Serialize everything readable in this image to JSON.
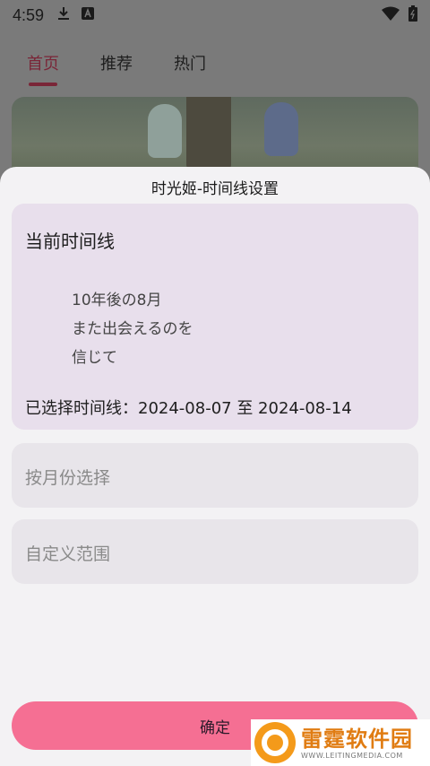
{
  "status_bar": {
    "time": "4:59",
    "icons": [
      "download-icon",
      "app-a-icon",
      "wifi-icon",
      "battery-icon"
    ]
  },
  "background_app": {
    "tabs": [
      {
        "label": "首页",
        "active": true
      },
      {
        "label": "推荐",
        "active": false
      },
      {
        "label": "热门",
        "active": false
      }
    ]
  },
  "sheet": {
    "title": "时光姬-时间线设置",
    "current_timeline": {
      "heading": "当前时间线",
      "poem": [
        "10年後の8月",
        "また出会えるのを",
        "信じて"
      ],
      "selected_label": "已选择时间线：2024-08-07 至 2024-08-14"
    },
    "options": [
      {
        "label": "按月份选择"
      },
      {
        "label": "自定义范围"
      }
    ],
    "confirm_label": "确定"
  },
  "watermark": {
    "name": "雷霆软件园",
    "url": "WWW.LEITINGMEDIA.COM"
  },
  "colors": {
    "accent": "#f56f93",
    "tab_active": "#7a2638",
    "current_card_bg": "#e8dfec",
    "option_card_bg": "#e8e5ea",
    "sheet_bg": "#f3f2f4"
  }
}
